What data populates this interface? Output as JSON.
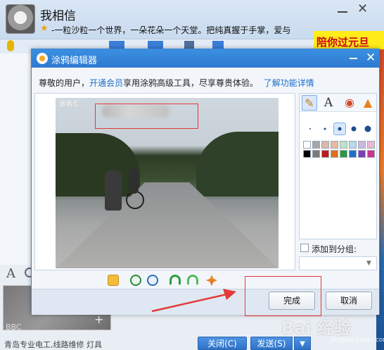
{
  "chat": {
    "contact_name": "我相信",
    "signature": "-一粒沙粒一个世界，一朵花朵一个天堂。把纯真握于手掌，爱与",
    "ad_banner": "陪你过元旦",
    "ad_text": "青岛专业电工,线路维修 灯具",
    "close_label": "关闭(C)",
    "send_label": "发送(S)",
    "thumbnail_caption": "BBC"
  },
  "dialog": {
    "title": "涂鸦编辑器",
    "notice_prefix": "尊敬的用户，",
    "notice_link": "开通会员",
    "notice_middle": "享用涂鸦高级工具，尽享尊贵体验。",
    "notice_detail_link": "了解功能详情",
    "photo_logo": "BBC",
    "add_to_group_label": "添加到分组:",
    "add_to_group_checked": false,
    "group_select_value": "",
    "done_label": "完成",
    "cancel_label": "取消",
    "selected_brush_size": 3,
    "palette": [
      "#ffffff",
      "#a6a6a6",
      "#d8b9a8",
      "#e8b9a0",
      "#bfe3c4",
      "#b9d8ea",
      "#c9b9e0",
      "#e8b9d0",
      "#000000",
      "#7a7a7a",
      "#c01818",
      "#e07018",
      "#2c9a3c",
      "#1f6fc9",
      "#7a3fb6",
      "#c8348c"
    ]
  },
  "watermark": {
    "text": "Bai 经验",
    "sub": "jingyan.baidu.com"
  }
}
